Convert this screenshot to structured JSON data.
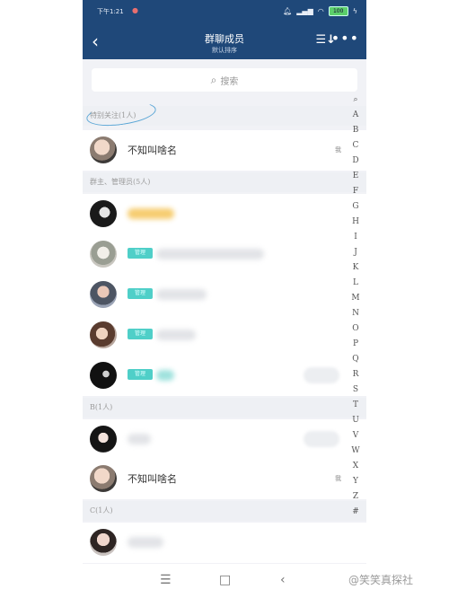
{
  "status_bar": {
    "time": "下午1:21",
    "battery": "100"
  },
  "header": {
    "title": "群聊成员",
    "subtitle": "默认排序",
    "back_icon": "back-arrow-icon",
    "sort_icon": "sort-icon",
    "more_icon": "more-icon"
  },
  "search": {
    "placeholder": "搜索"
  },
  "sections": {
    "special": "特别关注(1人)",
    "admins": "群主、管理员(5人)",
    "b": "B(1人)",
    "c": "C(1人)"
  },
  "members": {
    "special": [
      {
        "name": "不知叫啥名",
        "role": "我"
      }
    ],
    "admins": [
      {
        "name": "",
        "badge": ""
      },
      {
        "name": "",
        "badge": "管理"
      },
      {
        "name": "",
        "badge": "管理"
      },
      {
        "name": "",
        "badge": "管理"
      },
      {
        "name": "",
        "badge": "管理"
      }
    ],
    "b": [
      {
        "name": ""
      },
      {
        "name": "不知叫啥名",
        "role": "我"
      }
    ],
    "c": [
      {
        "name": ""
      }
    ]
  },
  "index_letters": [
    "A",
    "B",
    "C",
    "D",
    "E",
    "F",
    "G",
    "H",
    "I",
    "J",
    "K",
    "L",
    "M",
    "N",
    "O",
    "P",
    "Q",
    "R",
    "S",
    "T",
    "U",
    "V",
    "W",
    "X",
    "Y",
    "Z",
    "#"
  ],
  "navbar": {
    "menu_icon": "menu-icon",
    "home_icon": "home-icon",
    "back_icon": "back-icon"
  },
  "watermark": "@笑笑真探社",
  "colors": {
    "header_bg": "#1f4879",
    "badge": "#4fcfc8"
  }
}
